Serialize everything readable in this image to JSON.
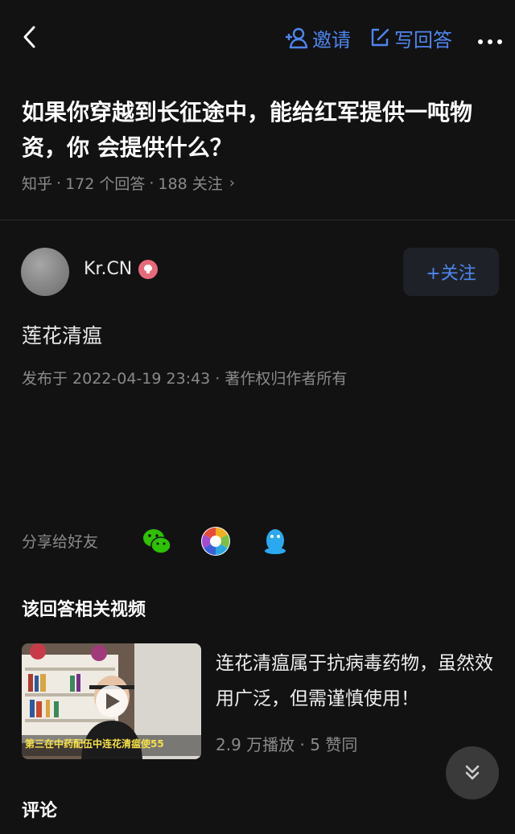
{
  "topbar": {
    "back_icon": "chevron-left-icon",
    "invite_label": "邀请",
    "write_answer_label": "写回答",
    "more_icon": "more-dots-icon",
    "accent_color": "#4e86f0"
  },
  "question": {
    "title": "如果你穿越到长征途中，能给红军提供一吨物资，你 会提供什么？",
    "source": "知乎",
    "answers_count": "172 个回答",
    "followers_count": "188 关注"
  },
  "answer": {
    "author_name": "Kr.CN",
    "follow_label": "+关注",
    "content": "莲花清瘟",
    "publish_info": "发布于 2022-04-19 23:43 · 著作权归作者所有"
  },
  "share": {
    "label": "分享给好友",
    "icons": [
      "wechat-icon",
      "moments-icon",
      "qq-icon"
    ]
  },
  "related_videos": {
    "section_title": "该回答相关视频",
    "items": [
      {
        "title": "连花清瘟属于抗病毒药物，虽然效用广泛，但需谨慎使用！",
        "plays": "2.9 万播放",
        "likes": "5 赞同",
        "thumb_caption": "第三在中药配伍中连花清瘟使55"
      }
    ]
  },
  "comments": {
    "section_title": "评论"
  }
}
